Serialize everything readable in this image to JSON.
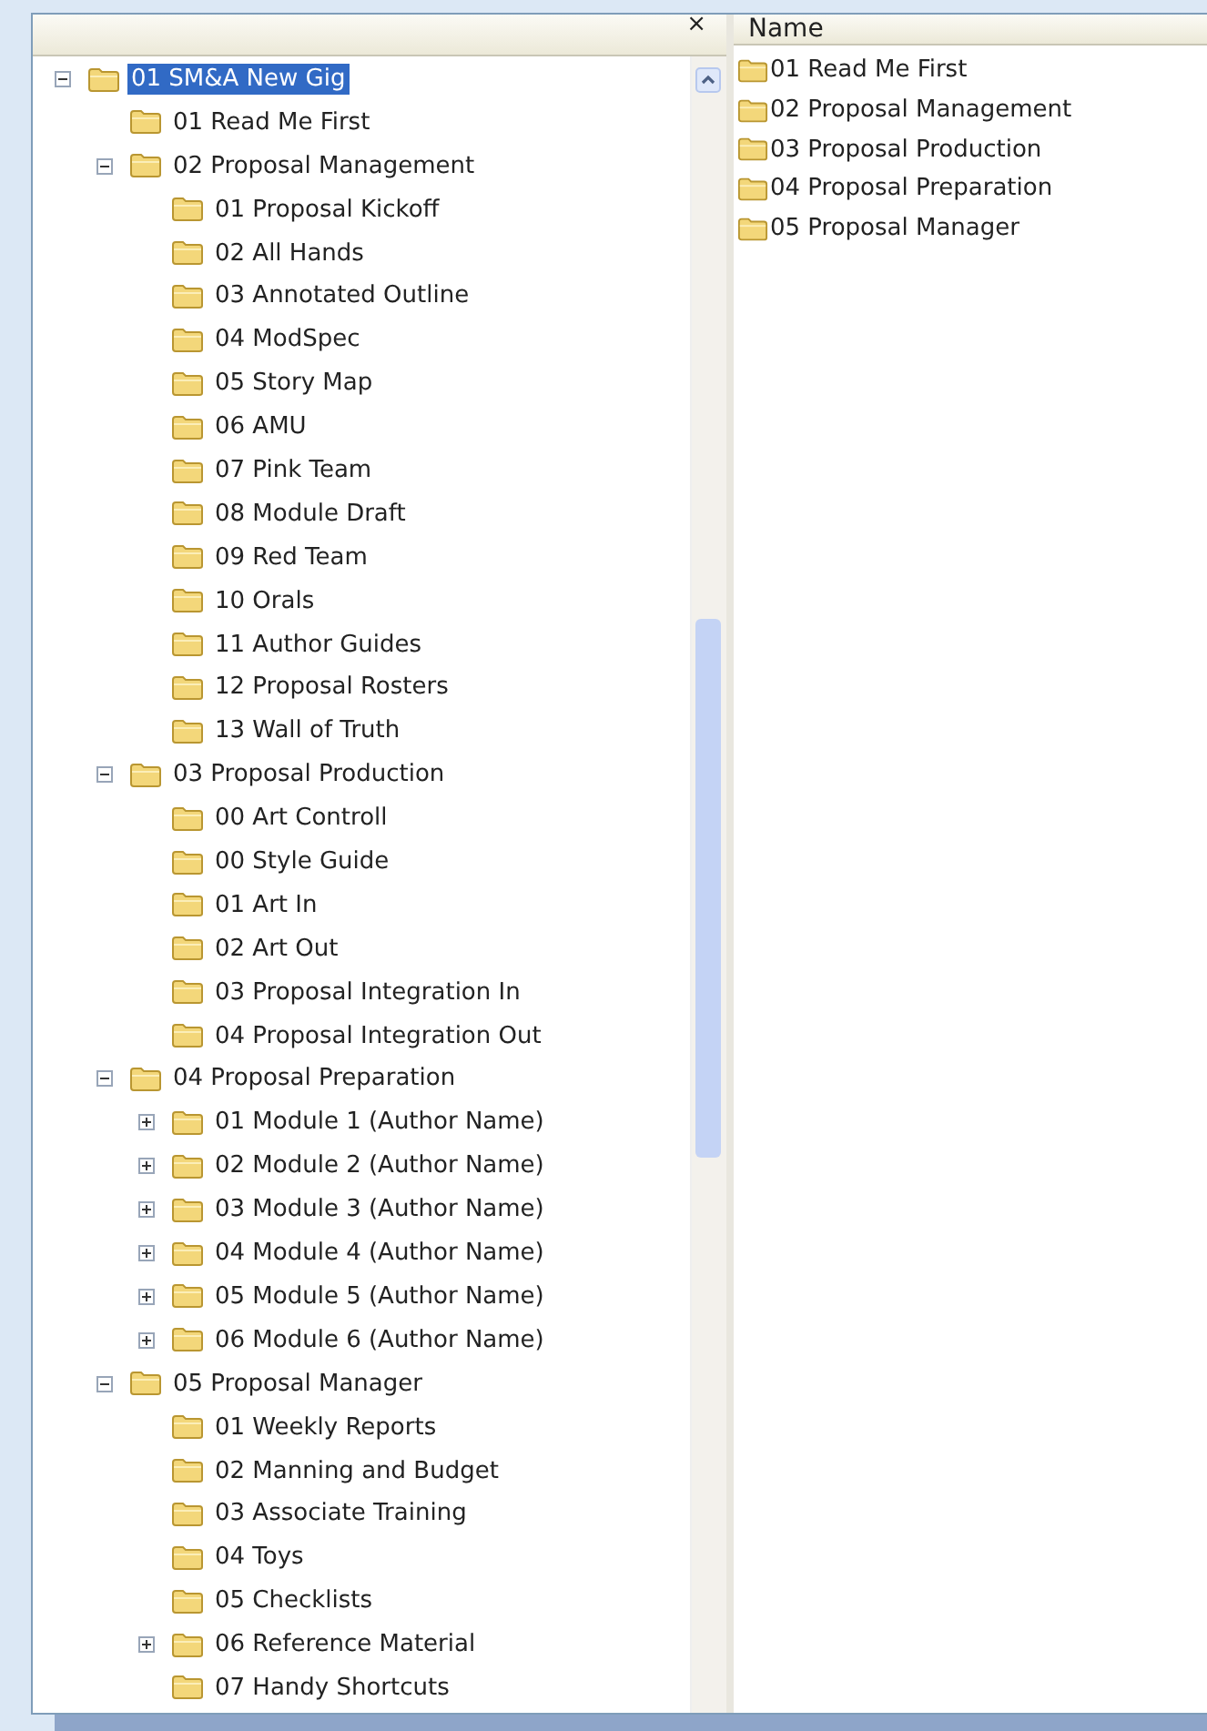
{
  "tree_pane": {
    "close_glyph": "×",
    "nodes": [
      {
        "label": "01 SM&A New Gig",
        "selected": true,
        "expanded": true,
        "children": [
          {
            "label": "01 Read Me First",
            "selected": false
          },
          {
            "label": "02 Proposal Management",
            "selected": false,
            "expanded": true,
            "children": [
              {
                "label": "01 Proposal Kickoff",
                "selected": false
              },
              {
                "label": "02 All Hands",
                "selected": false
              },
              {
                "label": "03 Annotated Outline",
                "selected": false
              },
              {
                "label": "04 ModSpec",
                "selected": false
              },
              {
                "label": "05 Story Map",
                "selected": false
              },
              {
                "label": "06 AMU",
                "selected": false
              },
              {
                "label": "07 Pink Team",
                "selected": false
              },
              {
                "label": "08 Module Draft",
                "selected": false
              },
              {
                "label": "09 Red Team",
                "selected": false
              },
              {
                "label": "10 Orals",
                "selected": false
              },
              {
                "label": "11 Author Guides",
                "selected": false
              },
              {
                "label": "12 Proposal Rosters",
                "selected": false
              },
              {
                "label": "13 Wall of Truth",
                "selected": false
              }
            ]
          },
          {
            "label": "03 Proposal Production",
            "selected": false,
            "expanded": true,
            "children": [
              {
                "label": "00 Art Controll",
                "selected": false
              },
              {
                "label": "00 Style Guide",
                "selected": false
              },
              {
                "label": "01 Art In",
                "selected": false
              },
              {
                "label": "02 Art Out",
                "selected": false
              },
              {
                "label": "03 Proposal Integration In",
                "selected": false
              },
              {
                "label": "04 Proposal Integration Out",
                "selected": false
              }
            ]
          },
          {
            "label": "04 Proposal Preparation",
            "selected": false,
            "expanded": true,
            "children": [
              {
                "label": "01 Module 1 (Author Name)",
                "selected": false,
                "expanded": false
              },
              {
                "label": "02 Module 2 (Author Name)",
                "selected": false,
                "expanded": false
              },
              {
                "label": "03 Module 3 (Author Name)",
                "selected": false,
                "expanded": false
              },
              {
                "label": "04 Module 4 (Author Name)",
                "selected": false,
                "expanded": false
              },
              {
                "label": "05 Module 5 (Author Name)",
                "selected": false,
                "expanded": false
              },
              {
                "label": "06 Module 6 (Author Name)",
                "selected": false,
                "expanded": false
              }
            ]
          },
          {
            "label": "05 Proposal Manager",
            "selected": false,
            "expanded": true,
            "children": [
              {
                "label": "01 Weekly Reports",
                "selected": false
              },
              {
                "label": "02 Manning and Budget",
                "selected": false
              },
              {
                "label": "03 Associate Training",
                "selected": false
              },
              {
                "label": "04 Toys",
                "selected": false
              },
              {
                "label": "05 Checklists",
                "selected": false
              },
              {
                "label": "06 Reference Material",
                "selected": false,
                "expanded": false
              },
              {
                "label": "07 Handy Shortcuts",
                "selected": false
              }
            ]
          }
        ]
      }
    ]
  },
  "list_pane": {
    "column_header": "Name",
    "items": [
      {
        "name": "01 Read Me First"
      },
      {
        "name": "02 Proposal Management"
      },
      {
        "name": "03 Proposal Production"
      },
      {
        "name": "04 Proposal Preparation"
      },
      {
        "name": "05 Proposal Manager"
      }
    ]
  }
}
